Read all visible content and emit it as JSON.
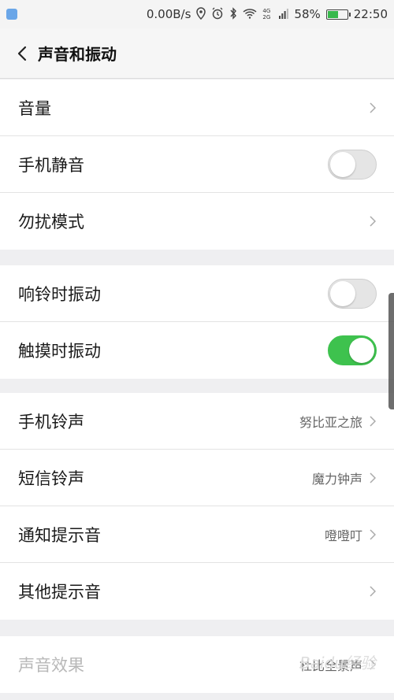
{
  "status_bar": {
    "speed": "0.00B/s",
    "net_labels": "4G 2G",
    "battery_percent": "58%",
    "battery_level": 0.58,
    "time": "22:50",
    "icons": [
      "location-icon",
      "alarm-icon",
      "bluetooth-icon",
      "wifi-icon",
      "signal-icon",
      "battery-icon"
    ]
  },
  "header": {
    "title": "声音和振动"
  },
  "groups": [
    {
      "items": [
        {
          "label": "音量",
          "type": "chevron"
        },
        {
          "label": "手机静音",
          "type": "toggle",
          "on": false
        },
        {
          "label": "勿扰模式",
          "type": "chevron"
        }
      ]
    },
    {
      "items": [
        {
          "label": "响铃时振动",
          "type": "toggle",
          "on": false
        },
        {
          "label": "触摸时振动",
          "type": "toggle",
          "on": true
        }
      ]
    },
    {
      "items": [
        {
          "label": "手机铃声",
          "value": "努比亚之旅",
          "type": "chevron"
        },
        {
          "label": "短信铃声",
          "value": "魔力钟声",
          "type": "chevron"
        },
        {
          "label": "通知提示音",
          "value": "噔噔叮",
          "type": "chevron"
        },
        {
          "label": "其他提示音",
          "type": "chevron"
        }
      ]
    },
    {
      "items": [
        {
          "label": "声音效果",
          "value": "杜比全景声",
          "type": "chevron",
          "disabled": true
        }
      ]
    }
  ],
  "watermark": "Baidu经验",
  "colors": {
    "toggle_on": "#3ec24e",
    "toggle_off": "#e5e5e5",
    "background": "#efeff1"
  }
}
